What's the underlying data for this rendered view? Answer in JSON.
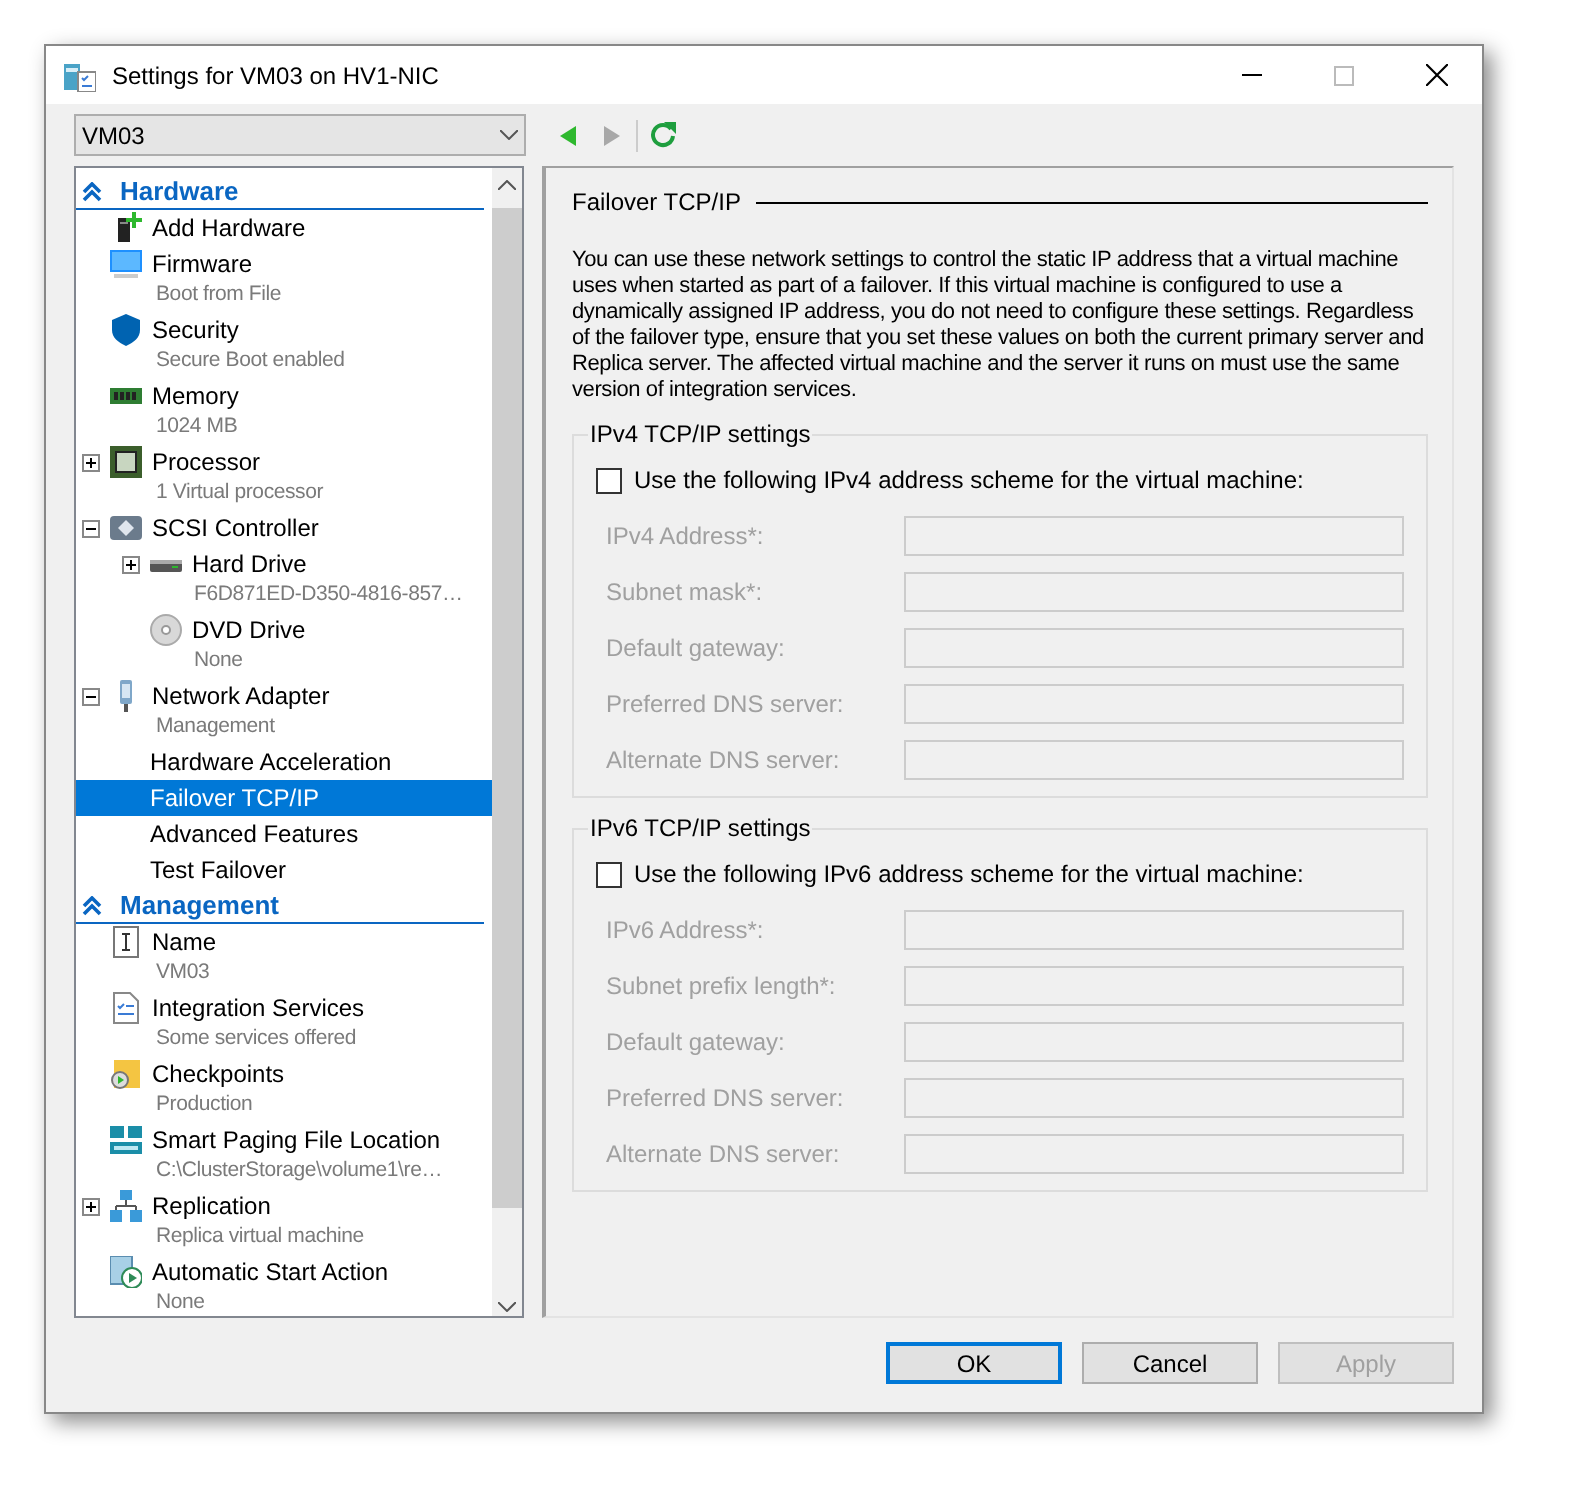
{
  "window": {
    "title": "Settings for VM03 on HV1-NIC"
  },
  "vm_select": {
    "value": "VM03"
  },
  "sidebar": {
    "sections": [
      {
        "title": "Hardware",
        "expanded": true,
        "items": [
          {
            "label": "Add Hardware",
            "selected": false
          },
          {
            "label": "Firmware",
            "detail": "Boot from File",
            "selected": false
          },
          {
            "label": "Security",
            "detail": "Secure Boot enabled",
            "selected": false
          },
          {
            "label": "Memory",
            "detail": "1024 MB",
            "selected": false
          },
          {
            "label": "Processor",
            "detail": "1 Virtual processor",
            "expanded": false,
            "selected": false
          },
          {
            "label": "SCSI Controller",
            "expanded": true,
            "selected": false,
            "children": [
              {
                "label": "Hard Drive",
                "detail": "F6D871ED-D350-4816-857…",
                "expanded": false,
                "selected": false
              },
              {
                "label": "DVD Drive",
                "detail": "None",
                "selected": false
              }
            ]
          },
          {
            "label": "Network Adapter",
            "detail": "Management",
            "expanded": true,
            "selected": false,
            "children": [
              {
                "label": "Hardware Acceleration",
                "selected": false
              },
              {
                "label": "Failover TCP/IP",
                "selected": true
              },
              {
                "label": "Advanced Features",
                "selected": false
              },
              {
                "label": "Test Failover",
                "selected": false
              }
            ]
          }
        ]
      },
      {
        "title": "Management",
        "expanded": true,
        "items": [
          {
            "label": "Name",
            "detail": "VM03",
            "selected": false
          },
          {
            "label": "Integration Services",
            "detail": "Some services offered",
            "selected": false
          },
          {
            "label": "Checkpoints",
            "detail": "Production",
            "selected": false
          },
          {
            "label": "Smart Paging File Location",
            "detail": "C:\\ClusterStorage\\volume1\\re…",
            "selected": false
          },
          {
            "label": "Replication",
            "detail": "Replica virtual machine",
            "expanded": false,
            "selected": false
          },
          {
            "label": "Automatic Start Action",
            "detail": "None",
            "selected": false
          }
        ]
      }
    ]
  },
  "panel": {
    "heading": "Failover TCP/IP",
    "description": "You can use these network settings to control the static IP address that a virtual machine uses when started as part of a failover. If this virtual machine is configured to use a dynamically assigned IP address, you do not need to configure these settings. Regardless of the failover type, ensure that you set these values on both the current primary server and Replica server. The affected virtual machine and the server it runs on must use the same version of integration services.",
    "groups": [
      {
        "title": "IPv4 TCP/IP settings",
        "checkbox": {
          "label": "Use the following IPv4 address scheme for the virtual machine:",
          "checked": false
        },
        "fields": [
          {
            "label": "IPv4 Address*:",
            "disabled": true
          },
          {
            "label": "Subnet mask*:",
            "disabled": true
          },
          {
            "label": "Default gateway:",
            "disabled": true
          },
          {
            "label": "Preferred DNS server:",
            "disabled": true
          },
          {
            "label": "Alternate DNS server:",
            "disabled": true
          }
        ]
      },
      {
        "title": "IPv6 TCP/IP settings",
        "checkbox": {
          "label": "Use the following IPv6 address scheme for the virtual machine:",
          "checked": false
        },
        "fields": [
          {
            "label": "IPv6 Address*:",
            "disabled": true
          },
          {
            "label": "Subnet prefix length*:",
            "disabled": true
          },
          {
            "label": "Default gateway:",
            "disabled": true
          },
          {
            "label": "Preferred DNS server:",
            "disabled": true
          },
          {
            "label": "Alternate DNS server:",
            "disabled": true
          }
        ]
      }
    ]
  },
  "buttons": [
    {
      "label": "OK",
      "kind": "default",
      "disabled": false
    },
    {
      "label": "Cancel",
      "kind": "normal",
      "disabled": false
    },
    {
      "label": "Apply",
      "kind": "normal",
      "disabled": true
    }
  ]
}
